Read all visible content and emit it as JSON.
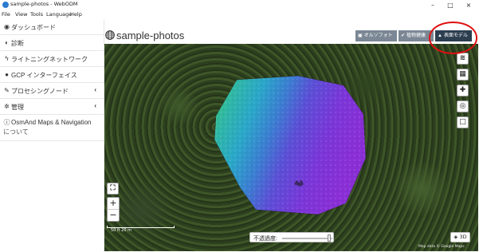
{
  "window": {
    "title": "sample-photos - WebODM",
    "controls": {
      "minimize": "–",
      "maximize": "□",
      "close": "×"
    }
  },
  "menubar": [
    "File",
    "View",
    "Tools",
    "Language",
    "Help"
  ],
  "sidebar": {
    "items": [
      {
        "icon": "dashboard-icon",
        "label": "ダッシュボード"
      },
      {
        "icon": "diagnostics-icon",
        "label": "診断"
      },
      {
        "icon": "lightning-icon",
        "label": "ライトニングネットワーク"
      },
      {
        "icon": "map-marker-icon",
        "label": "GCP インターフェイス"
      },
      {
        "icon": "wrench-icon",
        "label": "プロセシングノード",
        "chevron": "‹"
      },
      {
        "icon": "cogs-icon",
        "label": "管理",
        "chevron": "‹"
      },
      {
        "icon": "info-icon",
        "label": "OsmAnd Maps & Navigation",
        "label2": "について"
      }
    ]
  },
  "main": {
    "title": "sample-photos",
    "buttons": [
      {
        "icon": "image-icon",
        "label": "オルソフォト"
      },
      {
        "icon": "leaf-icon",
        "label": "植物健康"
      },
      {
        "icon": "area-chart-icon",
        "label": "表面モデル"
      }
    ]
  },
  "map": {
    "controls": {
      "fullscreen": "⛶",
      "zoom_in": "+",
      "zoom_out": "−"
    },
    "scale_label": "50 ft   20 m",
    "opacity_label": "不透過度:",
    "opacity_value": 1.0,
    "btn3d_label": "3D",
    "attribution": "Map data © Google Maps"
  },
  "colors": {
    "btn_ortho": "#7b8794",
    "btn_plant": "#7b8794",
    "btn_surface": "#2c3e50",
    "highlight": "#e01010"
  }
}
